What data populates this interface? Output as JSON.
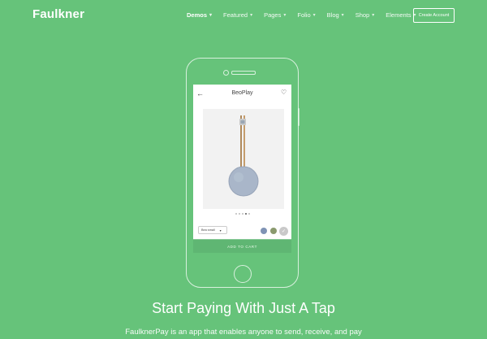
{
  "header": {
    "logo": "Faulkner",
    "nav": [
      {
        "label": "Demos",
        "active": true
      },
      {
        "label": "Featured",
        "active": false
      },
      {
        "label": "Pages",
        "active": false
      },
      {
        "label": "Folio",
        "active": false
      },
      {
        "label": "Blog",
        "active": false
      },
      {
        "label": "Shop",
        "active": false
      },
      {
        "label": "Elements",
        "active": false
      }
    ],
    "chevron": "⌄",
    "cta_label": "Create Account"
  },
  "phone": {
    "screen_title": "BeoPlay",
    "back_icon": "arrow-left-icon",
    "heart_icon": "heart-icon",
    "carousel_dots": 5,
    "active_dot": 3,
    "size_option": "Bea small",
    "swatches": [
      "#7f93b5",
      "#8a9a6e"
    ],
    "selected_swatch_color": "#c9c9c9",
    "add_to_cart": "ADD TO CART"
  },
  "hero": {
    "headline": "Start Paying With Just A Tap",
    "subtext": "FaulknerPay is an app that enables anyone to send, receive, and pay"
  },
  "colors": {
    "background": "#66c37a",
    "button": "#5fb673"
  }
}
